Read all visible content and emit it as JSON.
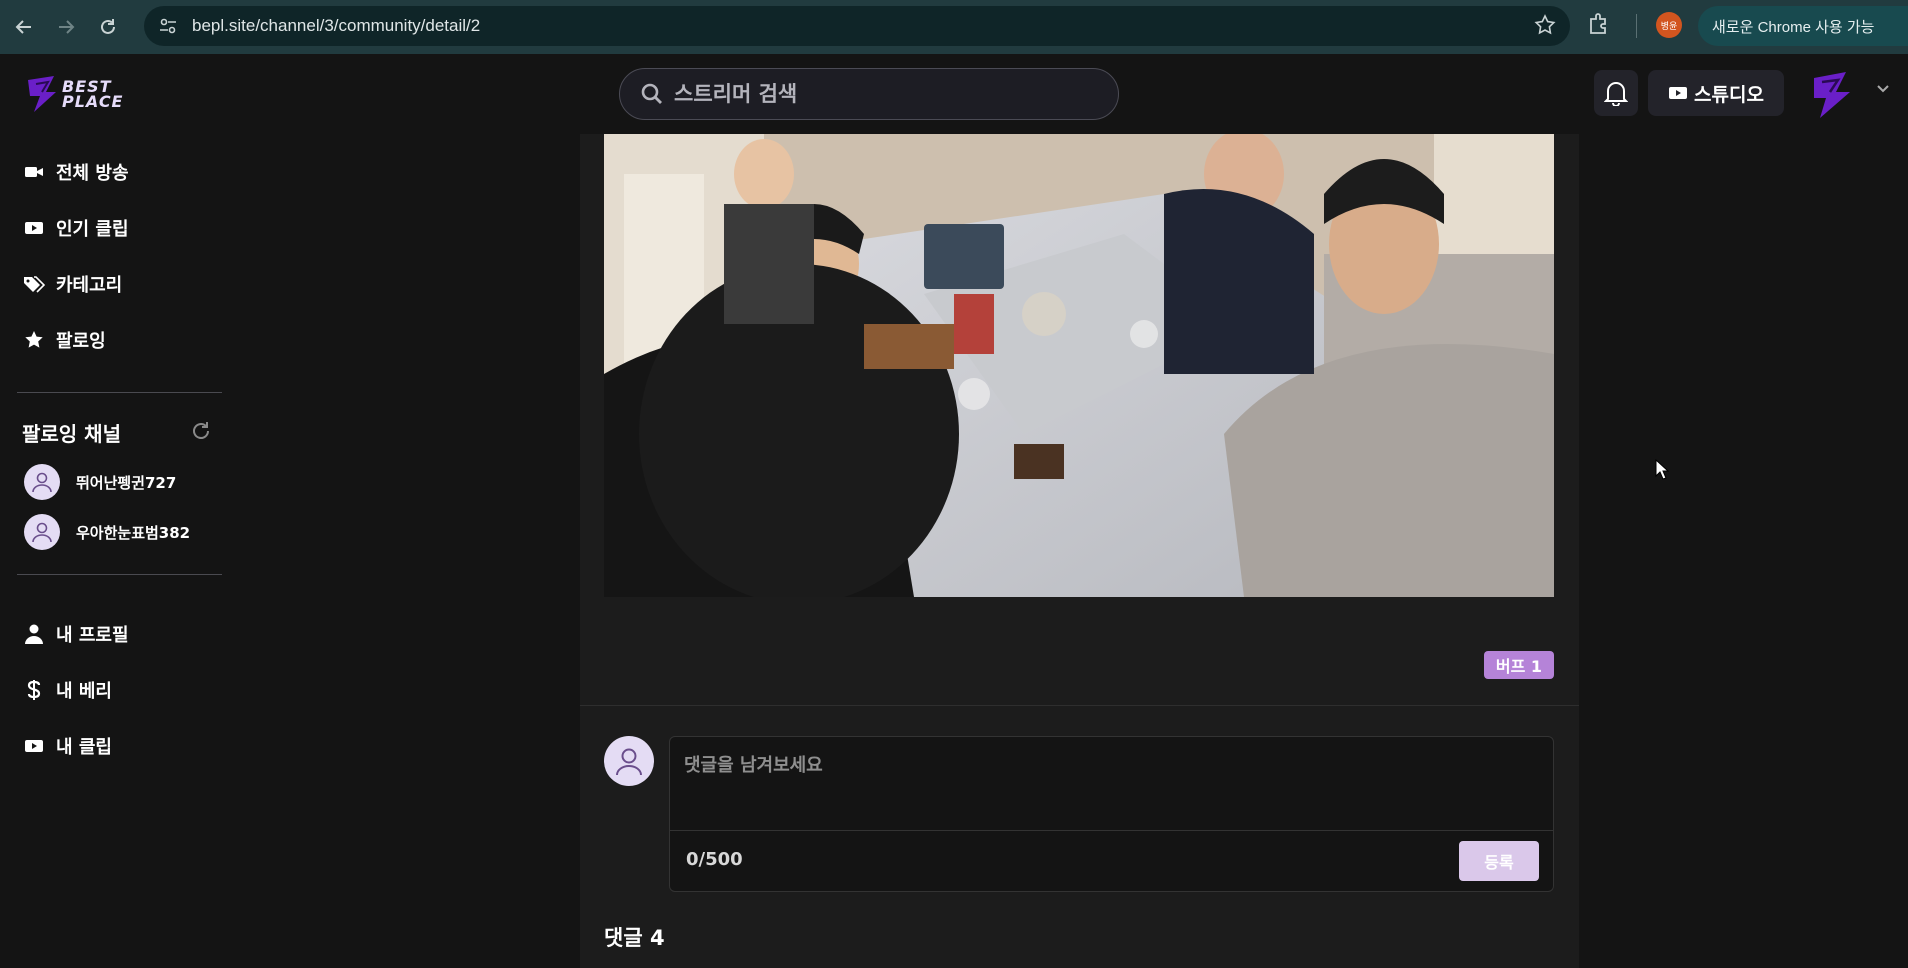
{
  "browser": {
    "url": "bepl.site/channel/3/community/detail/2",
    "profile_label": "병윤",
    "update_label": "새로운 Chrome 사용 가능"
  },
  "header": {
    "logo_text_line1": "BEST",
    "logo_text_line2": "PLACE",
    "search_placeholder": "스트리머 검색",
    "studio_label": "스튜디오"
  },
  "sidebar": {
    "main_items": [
      {
        "label": "전체 방송",
        "icon": "video-camera-icon"
      },
      {
        "label": "인기 클립",
        "icon": "clip-icon"
      },
      {
        "label": "카테고리",
        "icon": "tags-icon"
      },
      {
        "label": "팔로잉",
        "icon": "star-icon"
      }
    ],
    "following_title": "팔로잉 채널",
    "following_channels": [
      {
        "name": "뛰어난펭귄727"
      },
      {
        "name": "우아한눈표범382"
      }
    ],
    "my_items": [
      {
        "label": "내 프로필",
        "icon": "user-icon"
      },
      {
        "label": "내 베리",
        "icon": "dollar-icon"
      },
      {
        "label": "내 클립",
        "icon": "clip-icon"
      }
    ]
  },
  "post": {
    "buff_label": "버프 1"
  },
  "comment_form": {
    "placeholder": "댓글을 남겨보세요",
    "counter": "0/500",
    "submit_label": "등록"
  },
  "comments": {
    "heading": "댓글 4"
  },
  "colors": {
    "accent": "#b583d8",
    "submit_disabled": "#dac8ea",
    "background": "#141414",
    "panel": "#1c1c1c"
  }
}
